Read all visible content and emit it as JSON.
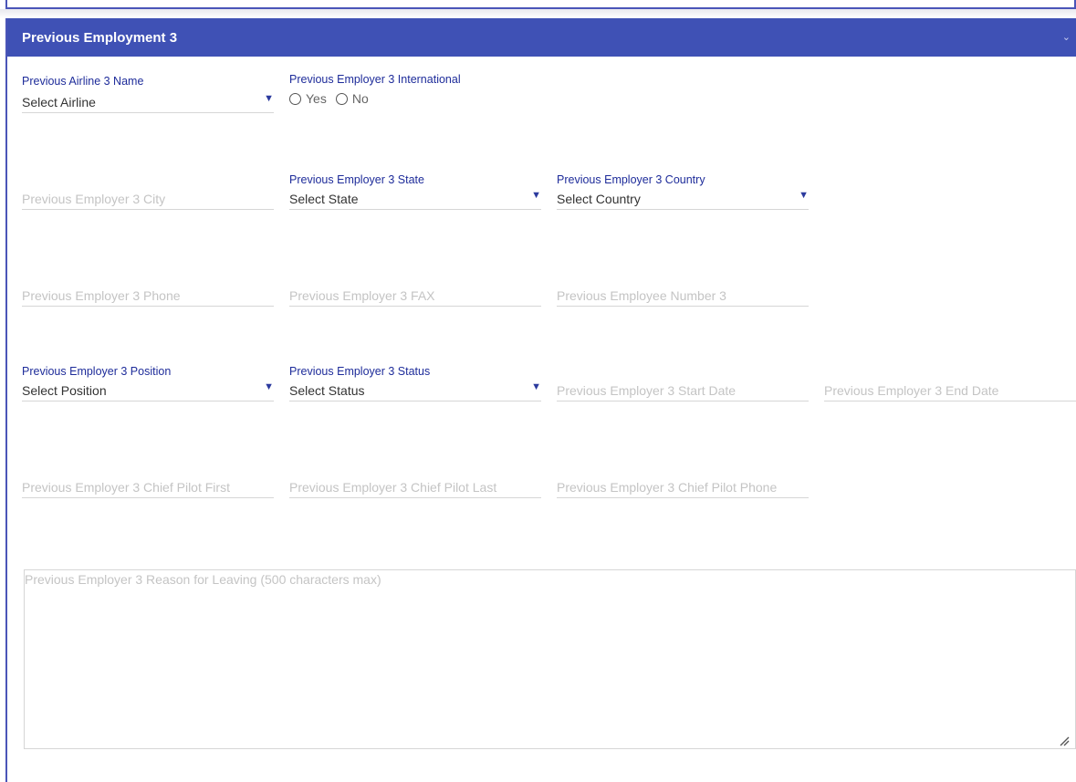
{
  "panel": {
    "title": "Previous Employment 3",
    "collapse_icon": "chevron-down-icon"
  },
  "airline": {
    "label": "Previous Airline 3 Name",
    "value": "Select Airline"
  },
  "international": {
    "label": "Previous Employer 3 International",
    "yes": "Yes",
    "no": "No"
  },
  "city": {
    "placeholder": "Previous Employer 3 City"
  },
  "state": {
    "label": "Previous Employer 3 State",
    "value": "Select State"
  },
  "country": {
    "label": "Previous Employer 3 Country",
    "value": "Select Country"
  },
  "phone": {
    "placeholder": "Previous Employer 3 Phone"
  },
  "fax": {
    "placeholder": "Previous Employer 3 FAX"
  },
  "employee_number": {
    "placeholder": "Previous Employee Number 3"
  },
  "position": {
    "label": "Previous Employer 3 Position",
    "value": "Select Position"
  },
  "status": {
    "label": "Previous Employer 3 Status",
    "value": "Select Status"
  },
  "start_date": {
    "placeholder": "Previous Employer 3 Start Date"
  },
  "end_date": {
    "placeholder": "Previous Employer 3 End Date"
  },
  "chief_pilot_first": {
    "placeholder": "Previous Employer 3 Chief Pilot First"
  },
  "chief_pilot_last": {
    "placeholder": "Previous Employer 3 Chief Pilot Last"
  },
  "chief_pilot_phone": {
    "placeholder": "Previous Employer 3 Chief Pilot Phone"
  },
  "reason": {
    "placeholder": "Previous Employer 3 Reason for Leaving (500 characters max)"
  },
  "colors": {
    "header": "#3f51b5",
    "label": "#1e2c9a",
    "placeholder": "#c4c4c4"
  }
}
